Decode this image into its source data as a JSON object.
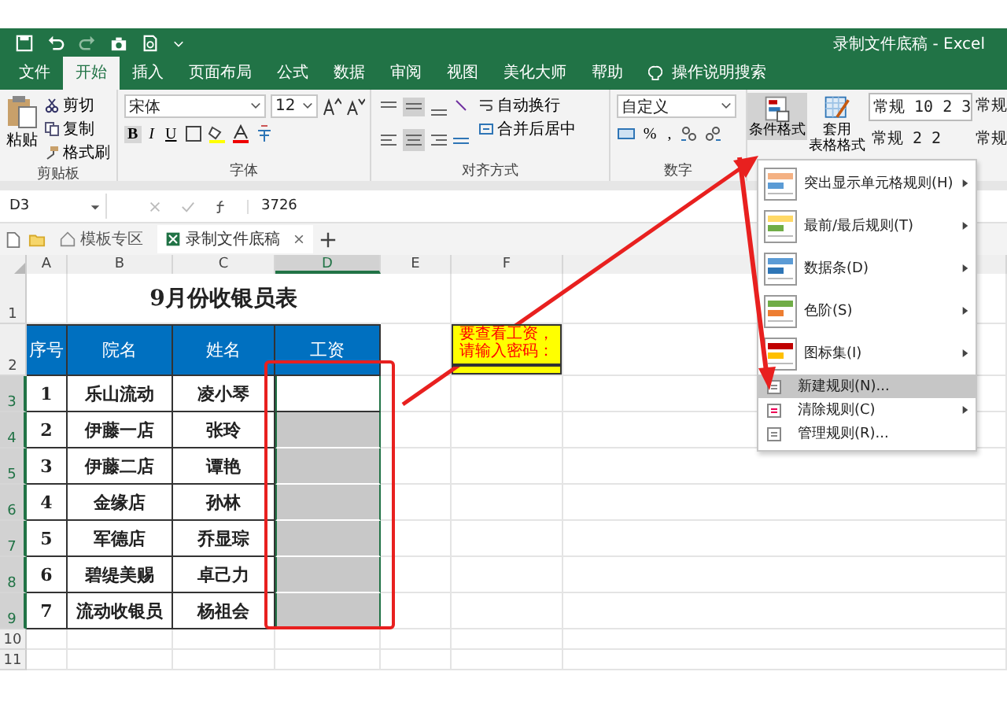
{
  "window": {
    "title": "录制文件底稿 - Excel"
  },
  "tabs": [
    {
      "label": "文件",
      "selected": false
    },
    {
      "label": "开始",
      "selected": true
    },
    {
      "label": "插入",
      "selected": false
    },
    {
      "label": "页面布局",
      "selected": false
    },
    {
      "label": "公式",
      "selected": false
    },
    {
      "label": "数据",
      "selected": false
    },
    {
      "label": "审阅",
      "selected": false
    },
    {
      "label": "视图",
      "selected": false
    },
    {
      "label": "美化大师",
      "selected": false
    },
    {
      "label": "帮助",
      "selected": false
    }
  ],
  "search_hint": "操作说明搜索",
  "ribbon": {
    "clipboard": {
      "paste": "粘贴",
      "cut": "剪切",
      "copy": "复制",
      "format_painter": "格式刷",
      "label": "剪贴板"
    },
    "font": {
      "name": "宋体",
      "size": "12",
      "bold": "B",
      "italic": "I",
      "underline": "U",
      "label": "字体"
    },
    "alignment": {
      "wrap": "自动换行",
      "merge": "合并后居中",
      "label": "对齐方式"
    },
    "number": {
      "format": "自定义",
      "percent": "%",
      "comma": ",",
      "label": "数字"
    },
    "styles": {
      "conditional": "条件格式",
      "table_line1": "套用",
      "table_line2": "表格格式",
      "cell_styles": [
        "常规 10 2 3",
        "常规",
        "常规 2 2",
        "常规"
      ]
    }
  },
  "formula_bar": {
    "name_box": "D3",
    "value": "3726"
  },
  "file_tabs": [
    {
      "label": "模板专区",
      "selected": false
    },
    {
      "label": "录制文件底稿",
      "selected": true
    }
  ],
  "sheet": {
    "columns": [
      {
        "label": "A",
        "selected": false
      },
      {
        "label": "B",
        "selected": false
      },
      {
        "label": "C",
        "selected": false
      },
      {
        "label": "D",
        "selected": true
      },
      {
        "label": "E",
        "selected": false
      },
      {
        "label": "F",
        "selected": false
      }
    ],
    "row_numbers": [
      {
        "label": "1",
        "selected": false
      },
      {
        "label": "2",
        "selected": false
      },
      {
        "label": "3",
        "selected": true
      },
      {
        "label": "4",
        "selected": true
      },
      {
        "label": "5",
        "selected": true
      },
      {
        "label": "6",
        "selected": true
      },
      {
        "label": "7",
        "selected": true
      },
      {
        "label": "8",
        "selected": true
      },
      {
        "label": "9",
        "selected": true
      },
      {
        "label": "10",
        "selected": false
      },
      {
        "label": "11",
        "selected": false
      }
    ],
    "title": "9月份收银员表",
    "headers": [
      "序号",
      "院名",
      "姓名",
      "工资"
    ],
    "rows": [
      {
        "no": "1",
        "store": "乐山流动",
        "name": "凌小琴",
        "selected": true,
        "active": true
      },
      {
        "no": "2",
        "store": "伊藤一店",
        "name": "张玲",
        "selected": true,
        "active": false
      },
      {
        "no": "3",
        "store": "伊藤二店",
        "name": "谭艳",
        "selected": true,
        "active": false
      },
      {
        "no": "4",
        "store": "金缘店",
        "name": "孙林",
        "selected": true,
        "active": false
      },
      {
        "no": "5",
        "store": "军德店",
        "name": "乔显琮",
        "selected": true,
        "active": false
      },
      {
        "no": "6",
        "store": "碧缇美赐",
        "name": "卓己力",
        "selected": true,
        "active": false
      },
      {
        "no": "7",
        "store": "流动收银员",
        "name": "杨祖会",
        "selected": true,
        "active": false
      }
    ],
    "note": [
      "要查看工资，",
      "请输入密码："
    ]
  },
  "menu": [
    {
      "label": "突出显示单元格规则(H)",
      "kind": "large",
      "has_submenu": true,
      "selected": false
    },
    {
      "label": "最前/最后规则(T)",
      "kind": "large",
      "has_submenu": true,
      "selected": false
    },
    {
      "label": "数据条(D)",
      "kind": "large",
      "has_submenu": true,
      "selected": false
    },
    {
      "label": "色阶(S)",
      "kind": "large",
      "has_submenu": true,
      "selected": false
    },
    {
      "label": "图标集(I)",
      "kind": "large",
      "has_submenu": true,
      "selected": false
    },
    {
      "label": "新建规则(N)...",
      "kind": "small",
      "has_submenu": false,
      "selected": true
    },
    {
      "label": "清除规则(C)",
      "kind": "small",
      "has_submenu": true,
      "selected": false
    },
    {
      "label": "管理规则(R)...",
      "kind": "small",
      "has_submenu": false,
      "selected": false
    }
  ]
}
